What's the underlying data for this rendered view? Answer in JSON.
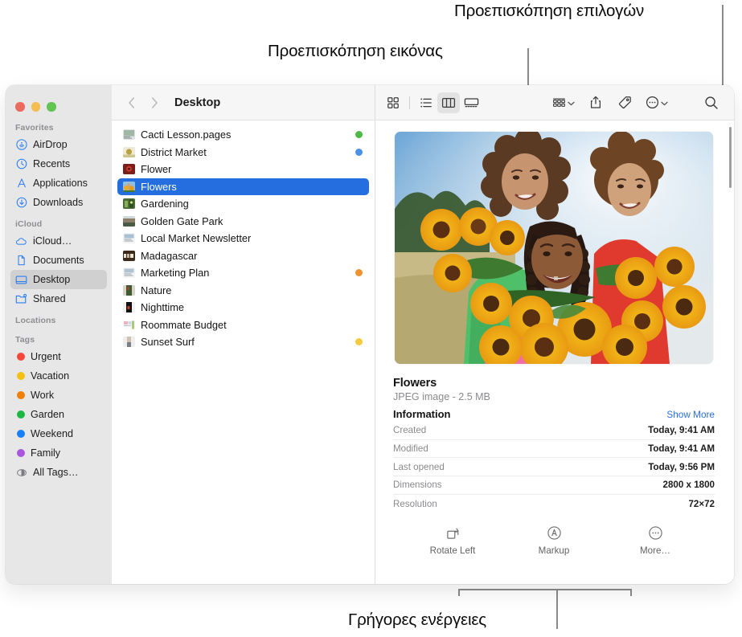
{
  "annotations": [
    {
      "id": "preview-options",
      "text": "Προεπισκόπηση επιλογών"
    },
    {
      "id": "image-preview",
      "text": "Προεπισκόπηση εικόνας"
    },
    {
      "id": "quick-actions",
      "text": "Γρήγορες ενέργειες"
    }
  ],
  "window": {
    "traffic_lights": [
      {
        "name": "close",
        "color": "#ec6a5f"
      },
      {
        "name": "minimize",
        "color": "#f4bd4f"
      },
      {
        "name": "zoom",
        "color": "#61c454"
      }
    ]
  },
  "toolbar": {
    "back_label": "‹",
    "forward_label": "›",
    "breadcrumb": "Desktop",
    "view_buttons": [
      {
        "name": "icon-view",
        "icon": "grid-icon",
        "active": false
      },
      {
        "name": "list-view",
        "icon": "list-icon",
        "active": false
      },
      {
        "name": "column-view",
        "icon": "columns-icon",
        "active": true
      },
      {
        "name": "gallery-view",
        "icon": "gallery-icon",
        "active": false
      }
    ],
    "action_buttons": [
      {
        "name": "group-by",
        "icon": "group-icon",
        "chevron": true
      },
      {
        "name": "share",
        "icon": "share-icon",
        "chevron": false
      },
      {
        "name": "tags",
        "icon": "tag-icon",
        "chevron": false
      },
      {
        "name": "more-actions",
        "icon": "ellipsis-circle-icon",
        "chevron": true
      },
      {
        "name": "search",
        "icon": "search-icon",
        "chevron": false
      }
    ]
  },
  "sidebar": {
    "sections": [
      {
        "title": "Favorites",
        "items": [
          {
            "label": "AirDrop",
            "icon": "airdrop-icon",
            "selected": false
          },
          {
            "label": "Recents",
            "icon": "clock-icon",
            "selected": false
          },
          {
            "label": "Applications",
            "icon": "applications-icon",
            "selected": false
          },
          {
            "label": "Downloads",
            "icon": "download-icon",
            "selected": false
          }
        ]
      },
      {
        "title": "iCloud",
        "items": [
          {
            "label": "iCloud…",
            "icon": "cloud-icon",
            "selected": false
          },
          {
            "label": "Documents",
            "icon": "document-icon",
            "selected": false
          },
          {
            "label": "Desktop",
            "icon": "desktop-icon",
            "selected": true
          },
          {
            "label": "Shared",
            "icon": "shared-folder-icon",
            "selected": false
          }
        ]
      },
      {
        "title": "Locations",
        "items": []
      },
      {
        "title": "Tags",
        "items": [
          {
            "label": "Urgent",
            "icon": "tag-dot",
            "color": "#f8453a",
            "selected": false
          },
          {
            "label": "Vacation",
            "icon": "tag-dot",
            "color": "#f5c014",
            "selected": false
          },
          {
            "label": "Work",
            "icon": "tag-dot",
            "color": "#ef8008",
            "selected": false
          },
          {
            "label": "Garden",
            "icon": "tag-dot",
            "color": "#1db842",
            "selected": false
          },
          {
            "label": "Weekend",
            "icon": "tag-dot",
            "color": "#1880f8",
            "selected": false
          },
          {
            "label": "Family",
            "icon": "tag-dot",
            "color": "#a855e0",
            "selected": false
          },
          {
            "label": "All Tags…",
            "icon": "all-tags-icon",
            "color": null,
            "selected": false
          }
        ]
      }
    ]
  },
  "files": [
    {
      "name": "Cacti Lesson.pages",
      "icon": "pages-doc-icon",
      "tag": "#4cbb45",
      "selected": false
    },
    {
      "name": "District Market",
      "icon": "photo-icon",
      "tag": "#4a90e8",
      "selected": false
    },
    {
      "name": "Flower",
      "icon": "photo-icon",
      "tag": null,
      "selected": false
    },
    {
      "name": "Flowers",
      "icon": "photo-icon",
      "tag": null,
      "selected": true
    },
    {
      "name": "Gardening",
      "icon": "photo-icon",
      "tag": null,
      "selected": false
    },
    {
      "name": "Golden Gate Park",
      "icon": "photo-icon",
      "tag": null,
      "selected": false
    },
    {
      "name": "Local Market Newsletter",
      "icon": "pages-doc-icon",
      "tag": null,
      "selected": false
    },
    {
      "name": "Madagascar",
      "icon": "photo-icon",
      "tag": null,
      "selected": false
    },
    {
      "name": "Marketing Plan",
      "icon": "pages-doc-icon",
      "tag": "#f0932f",
      "selected": false
    },
    {
      "name": "Nature",
      "icon": "photo-icon",
      "tag": null,
      "selected": false
    },
    {
      "name": "Nighttime",
      "icon": "photo-icon",
      "tag": null,
      "selected": false
    },
    {
      "name": "Roommate Budget",
      "icon": "numbers-doc-icon",
      "tag": null,
      "selected": false
    },
    {
      "name": "Sunset Surf",
      "icon": "photo-icon",
      "tag": "#f5ca3c",
      "selected": false
    }
  ],
  "preview": {
    "file_title": "Flowers",
    "file_subtitle": "JPEG image - 2.5 MB",
    "info_heading": "Information",
    "show_more_label": "Show More",
    "info_rows": [
      {
        "key": "Created",
        "value": "Today, 9:41 AM"
      },
      {
        "key": "Modified",
        "value": "Today, 9:41 AM"
      },
      {
        "key": "Last opened",
        "value": "Today, 9:56 PM"
      },
      {
        "key": "Dimensions",
        "value": "2800 x 1800"
      },
      {
        "key": "Resolution",
        "value": "72×72"
      }
    ],
    "quick_actions": [
      {
        "label": "Rotate Left",
        "icon": "rotate-left-icon"
      },
      {
        "label": "Markup",
        "icon": "markup-icon"
      },
      {
        "label": "More…",
        "icon": "ellipsis-circle-icon"
      }
    ]
  },
  "colors": {
    "selection_blue": "#246ee0",
    "link_blue": "#2b6ede",
    "sidebar_bg": "#e7e7e7",
    "toolbar_bg": "#f6f6f6"
  }
}
